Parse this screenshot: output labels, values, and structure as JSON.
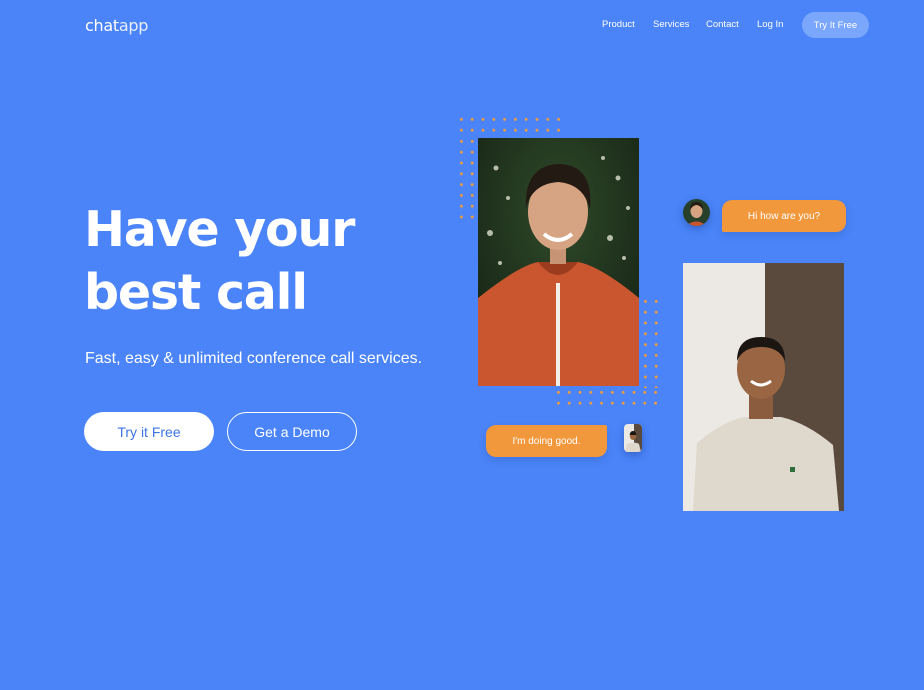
{
  "header": {
    "logo_bold": "chat",
    "logo_light": "app",
    "nav": [
      "Product",
      "Services",
      "Contact",
      "Log In"
    ],
    "cta": "Try It Free"
  },
  "hero": {
    "title_line1": "Have your",
    "title_line2": "best call",
    "subtitle": "Fast, easy & unlimited conference call services.",
    "primary_button": "Try it Free",
    "secondary_button": "Get a Demo"
  },
  "chat": {
    "incoming_message": "Hi how are you?",
    "outgoing_message": "I'm doing good."
  },
  "colors": {
    "background": "#4a84f8",
    "accent": "#f1983d",
    "primary_button_text": "#3c74e6"
  }
}
